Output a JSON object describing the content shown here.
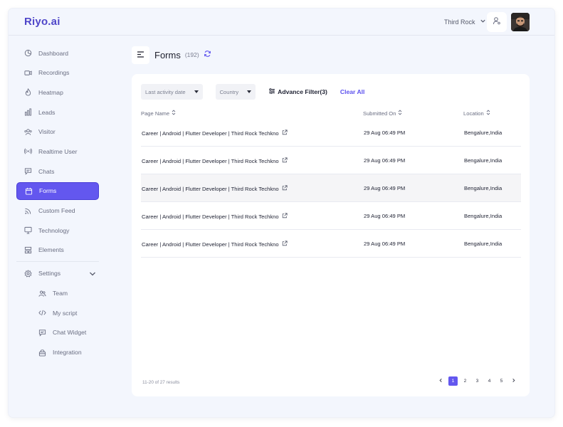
{
  "app": {
    "logo": "Riyo.ai"
  },
  "header": {
    "org_name": "Third Rock"
  },
  "sidebar": {
    "items": [
      {
        "label": "Dashboard",
        "icon": "pie-chart-icon"
      },
      {
        "label": "Recordings",
        "icon": "video-icon"
      },
      {
        "label": "Heatmap",
        "icon": "flame-icon"
      },
      {
        "label": "Leads",
        "icon": "bar-chart-icon"
      },
      {
        "label": "Visitor",
        "icon": "users-icon"
      },
      {
        "label": "Realtime User",
        "icon": "broadcast-icon"
      },
      {
        "label": "Chats",
        "icon": "chat-icon"
      },
      {
        "label": "Forms",
        "icon": "calendar-icon",
        "active": true
      },
      {
        "label": "Custom Feed",
        "icon": "rss-icon"
      },
      {
        "label": "Technology",
        "icon": "monitor-icon"
      },
      {
        "label": "Elements",
        "icon": "layout-icon"
      }
    ],
    "settings": {
      "label": "Settings",
      "icon": "gear-icon"
    },
    "sub_items": [
      {
        "label": "Team",
        "icon": "team-icon"
      },
      {
        "label": "My script",
        "icon": "code-icon"
      },
      {
        "label": "Chat Widget",
        "icon": "chat-widget-icon"
      },
      {
        "label": "Integration",
        "icon": "lock-icon"
      }
    ]
  },
  "page": {
    "title": "Forms",
    "count": "(192)"
  },
  "filters": {
    "activity": "Last activity date",
    "country": "Country",
    "advance": "Advance Filter(3)",
    "clear": "Clear All"
  },
  "table": {
    "columns": [
      "Page Name",
      "Submitted On",
      "Location"
    ],
    "rows": [
      {
        "page": "Career | Android | Flutter Developer | Third Rock Techkno",
        "submitted": "29 Aug 06:49 PM",
        "location": "Bengalure,India"
      },
      {
        "page": "Career | Android | Flutter Developer | Third Rock Techkno",
        "submitted": "29 Aug 06:49 PM",
        "location": "Bengalure,India"
      },
      {
        "page": "Career | Android | Flutter Developer | Third Rock Techkno",
        "submitted": "29 Aug 06:49 PM",
        "location": "Bengalure,India"
      },
      {
        "page": "Career | Android | Flutter Developer | Third Rock Techkno",
        "submitted": "29 Aug 06:49 PM",
        "location": "Bengalure,India"
      },
      {
        "page": "Career | Android | Flutter Developer | Third Rock Techkno",
        "submitted": "29 Aug 06:49 PM",
        "location": "Bengalure,India"
      }
    ]
  },
  "footer": {
    "results": "11-20 of 27 results",
    "pages": [
      "1",
      "2",
      "3",
      "4",
      "5"
    ],
    "current_page": "1"
  },
  "colors": {
    "accent": "#6357ef",
    "logo": "#4f46c9",
    "background": "#f3f6fd"
  }
}
